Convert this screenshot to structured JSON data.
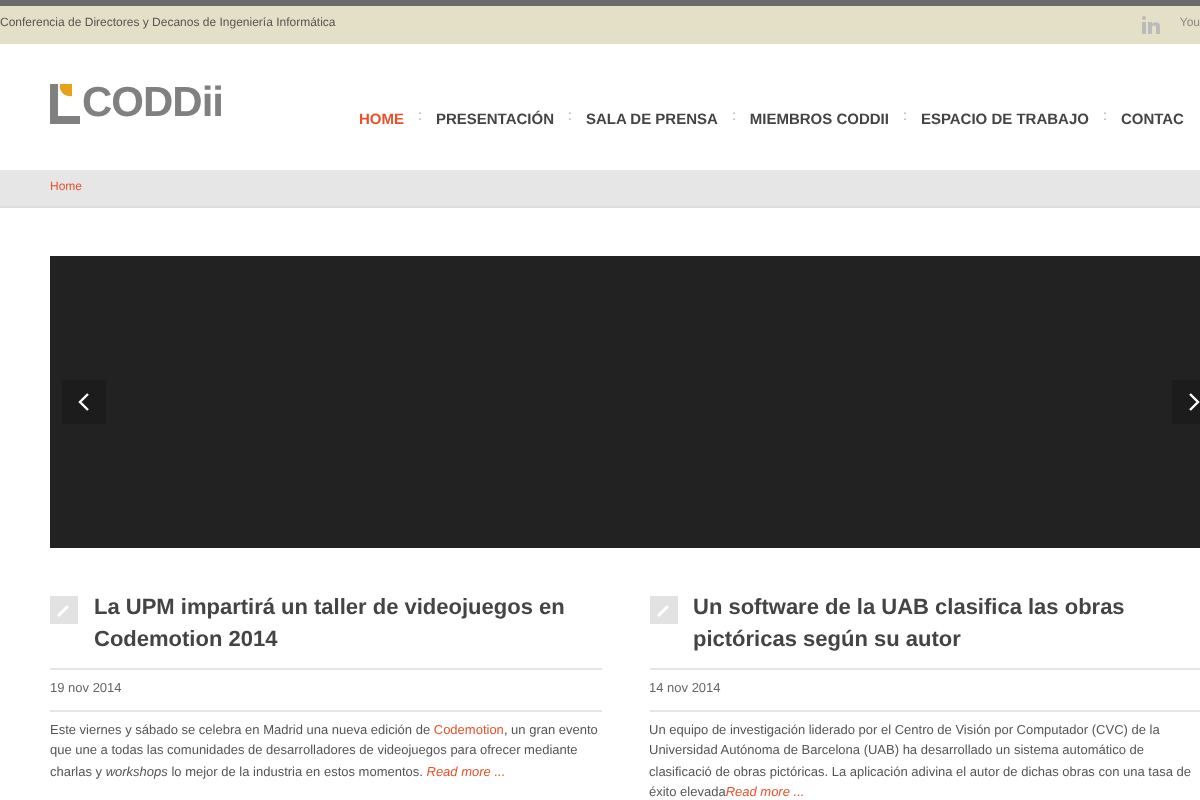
{
  "top_bar": {
    "tagline": "Conferencia de Directores y Decanos de Ingeniería Informática",
    "social": [
      "You"
    ]
  },
  "header": {
    "logo": "CODDii",
    "separator": ":",
    "nav": [
      {
        "label": "HOME",
        "selected": true
      },
      {
        "label": "PRESENTACIÓN",
        "selected": false
      },
      {
        "label": "SALA DE PRENSA",
        "selected": false
      },
      {
        "label": "MIEMBROS CODDII",
        "selected": false
      },
      {
        "label": "ESPACIO DE TRABAJO",
        "selected": false
      },
      {
        "label": "CONTAC",
        "selected": false
      }
    ]
  },
  "breadcrumb": [
    "Home"
  ],
  "articles": [
    {
      "title": "La UPM impartirá un taller de videojuegos en Codemotion 2014",
      "date": "19 nov 2014",
      "body": [
        "Este viernes y sábado se celebra en Madrid una nueva edición de ",
        "Codemotion",
        ", un gran evento que une a todas las comunidades de desarrolladores de videojuegos para ofrecer mediante charlas y ",
        "workshops",
        " lo mejor de la industria en estos momentos. "
      ],
      "more": "Read more ..."
    },
    {
      "title": "Un software de la UAB clasifica las obras pictóricas según su autor",
      "date": "14 nov 2014",
      "body": [
        "Un equipo de investigación liderado por el Centro de Visión por Computador (CVC) de la Universidad Autónoma de Barcelona (UAB) ha desarrollado un sistema automático de clasificació de obras pictóricas. La aplicación adivina el autor de dichas obras con una tasa de éxito elevada"
      ],
      "more": "Read more ..."
    }
  ]
}
